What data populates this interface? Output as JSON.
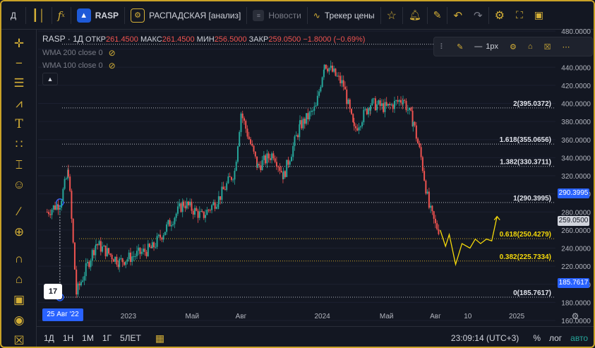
{
  "topbar": {
    "account_initial": "Д",
    "symbol": "RASP",
    "indicator_name": "РАСПАДСКАЯ [анализ]",
    "news_label": "Новости",
    "tracker_label": "Трекер цены"
  },
  "legend": {
    "symbol_tf": "RASP · 1Д",
    "open_label": "ОТКР",
    "open_value": "261.4500",
    "high_label": "МАКС",
    "high_value": "261.4500",
    "low_label": "МИН",
    "low_value": "256.5000",
    "close_label": "ЗАКР",
    "close_value": "259.0500",
    "change_value": "−1.8000 (−0.69%)",
    "wma200": "WMA 200 close 0",
    "wma100": "WMA 100 close 0"
  },
  "drawbar": {
    "width_label": "1px"
  },
  "fib_levels": [
    {
      "label": "2(395.0372)",
      "price": 395.0372
    },
    {
      "label": "1.618(355.0656)",
      "price": 355.0656
    },
    {
      "label": "1.382(330.3711)",
      "price": 330.3711
    },
    {
      "label": "1(290.3995)",
      "price": 290.3995
    },
    {
      "label": "0.618(250.4279)",
      "price": 250.4279
    },
    {
      "label": "0.382(225.7334)",
      "price": 225.7334
    },
    {
      "label": "0(185.7617)",
      "price": 185.7617
    }
  ],
  "price_axis": {
    "ticks": [
      "480.0000",
      "460.0000",
      "440.0000",
      "420.0000",
      "400.0000",
      "380.0000",
      "360.0000",
      "340.0000",
      "320.0000",
      "300.0000",
      "280.0000",
      "260.0000",
      "240.0000",
      "220.0000",
      "200.0000",
      "180.0000",
      "160.0000"
    ],
    "tag_fib1": "290.3995",
    "tag_last": "259.0500",
    "tag_fib0": "185.7617"
  },
  "time_axis": {
    "labels": [
      "2023",
      "Май",
      "Авг",
      "2024",
      "Май",
      "Авг",
      "10",
      "2025"
    ],
    "cursor_date": "25 Авг '22"
  },
  "bottombar": {
    "ranges": [
      "1Д",
      "1Н",
      "1М",
      "1Г",
      "5ЛЕТ"
    ],
    "time": "23:09:14 (UTC+3)",
    "percent": "%",
    "log": "лог",
    "auto": "авто"
  },
  "colors": {
    "up": "#26a69a",
    "down": "#ef5350",
    "accent": "#d4af37",
    "blue": "#2962ff",
    "projection": "#f5d90a"
  },
  "chart_data": {
    "type": "candlestick",
    "ylim": [
      160,
      480
    ],
    "x_labels": [
      "2023",
      "Май",
      "Авг",
      "2024",
      "Май",
      "Авг",
      "10",
      "2025"
    ],
    "anchor_points": [
      {
        "date": "2022-08-01",
        "price": 280
      },
      {
        "date": "2022-08-25",
        "price": 290
      },
      {
        "date": "2022-09-10",
        "price": 325
      },
      {
        "date": "2022-09-25",
        "price": 190
      },
      {
        "date": "2022-11-01",
        "price": 245
      },
      {
        "date": "2022-12-15",
        "price": 225
      },
      {
        "date": "2023-02-15",
        "price": 240
      },
      {
        "date": "2023-04-15",
        "price": 290
      },
      {
        "date": "2023-05-20",
        "price": 275
      },
      {
        "date": "2023-06-20",
        "price": 295
      },
      {
        "date": "2023-07-20",
        "price": 325
      },
      {
        "date": "2023-08-01",
        "price": 390
      },
      {
        "date": "2023-09-01",
        "price": 330
      },
      {
        "date": "2023-10-01",
        "price": 345
      },
      {
        "date": "2023-10-20",
        "price": 320
      },
      {
        "date": "2023-11-20",
        "price": 375
      },
      {
        "date": "2023-12-20",
        "price": 395
      },
      {
        "date": "2024-01-05",
        "price": 445
      },
      {
        "date": "2024-01-20",
        "price": 435
      },
      {
        "date": "2024-02-10",
        "price": 420
      },
      {
        "date": "2024-03-01",
        "price": 370
      },
      {
        "date": "2024-04-01",
        "price": 400
      },
      {
        "date": "2024-05-01",
        "price": 395
      },
      {
        "date": "2024-06-01",
        "price": 405
      },
      {
        "date": "2024-06-20",
        "price": 380
      },
      {
        "date": "2024-07-05",
        "price": 340
      },
      {
        "date": "2024-07-20",
        "price": 285
      },
      {
        "date": "2024-08-01",
        "price": 265
      },
      {
        "date": "2024-08-10",
        "price": 259.05
      }
    ],
    "projection_path": [
      {
        "date": "2024-08-10",
        "price": 260
      },
      {
        "date": "2024-08-20",
        "price": 242
      },
      {
        "date": "2024-08-27",
        "price": 255
      },
      {
        "date": "2024-09-08",
        "price": 222
      },
      {
        "date": "2024-09-20",
        "price": 245
      },
      {
        "date": "2024-10-05",
        "price": 240
      },
      {
        "date": "2024-10-15",
        "price": 250
      },
      {
        "date": "2024-10-25",
        "price": 245
      },
      {
        "date": "2024-11-05",
        "price": 250
      },
      {
        "date": "2024-11-15",
        "price": 248
      },
      {
        "date": "2024-11-25",
        "price": 275
      }
    ]
  }
}
